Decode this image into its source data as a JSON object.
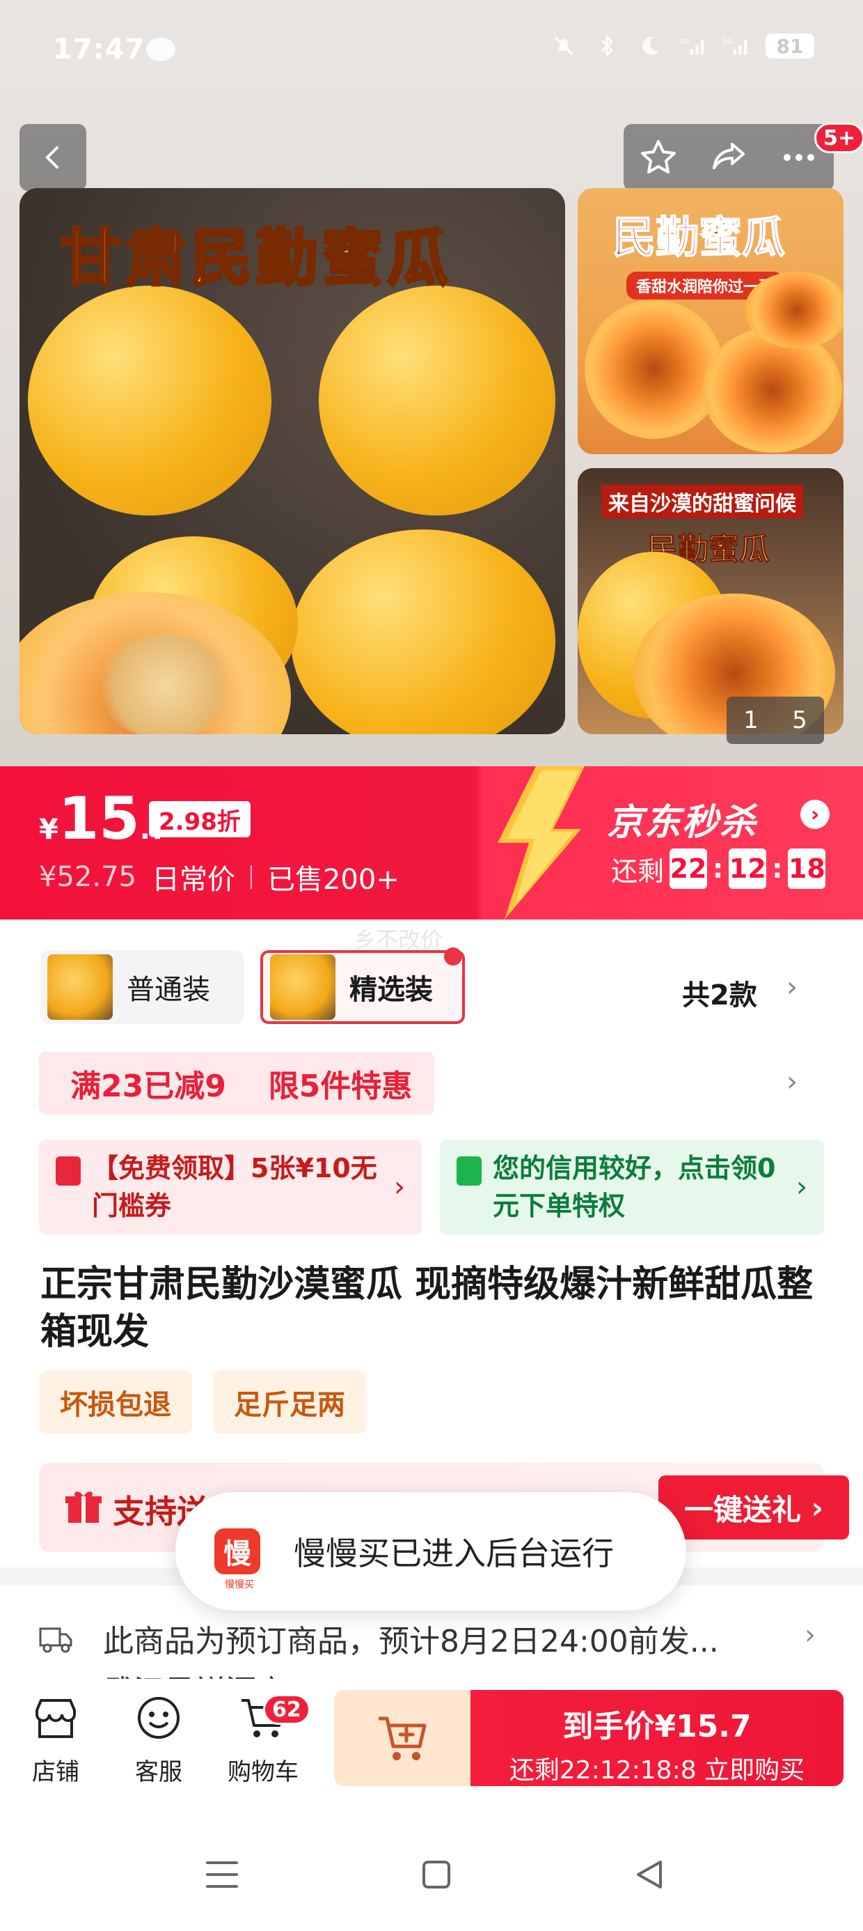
{
  "status_bar": {
    "time": "17:47",
    "icons": [
      "wechat-icon",
      "mute-icon",
      "bluetooth-icon",
      "moon-icon",
      "signal-5g-icon",
      "signal-5g-icon"
    ],
    "battery": "81"
  },
  "header": {
    "message_badge": "5+"
  },
  "gallery": {
    "main_title": "甘肃民勤蜜瓜",
    "side1_title": "民勤蜜瓜",
    "side1_subtitle": "香甜水润陪你过一夏",
    "side2_title": "来自沙漠的甜蜜问候",
    "side2_subtitle": "民勤蜜瓜",
    "pager_current": "1",
    "pager_total": "5"
  },
  "price": {
    "currency": "¥",
    "integer": "15",
    "decimal": ".7",
    "discount": "2.98折",
    "original": "¥52.75",
    "original_label": "日常价",
    "sold": "已售200+",
    "flash_title": "京东秒杀",
    "countdown_label": "还剩",
    "countdown": [
      "22",
      "12",
      "18"
    ]
  },
  "tip_text": "乡不改价",
  "variants": {
    "items": [
      {
        "label": "普通装"
      },
      {
        "label": "精选装"
      }
    ],
    "total": "共2款"
  },
  "promos": [
    "满23已减9",
    "限5件特惠"
  ],
  "coupons": [
    {
      "text": "【免费领取】5张¥10无门槛券"
    },
    {
      "text": "您的信用较好，点击领0元下单特权"
    }
  ],
  "product": {
    "title": "正宗甘肃民勤沙漠蜜瓜 现摘特级爆汁新鲜甜瓜整箱现发",
    "tags": [
      "坏损包退",
      "足斤足两"
    ]
  },
  "gift": {
    "text": "支持送",
    "button": "一键送礼"
  },
  "toast": {
    "logo": "慢",
    "logo_sub": "慢慢买",
    "text": "慢慢买已进入后台运行"
  },
  "shipping": {
    "text": "此商品为预订商品，预计8月2日24:00前发...",
    "text2": "武汉吴祥源方"
  },
  "bottom_bar": {
    "store": "店铺",
    "service": "客服",
    "cart": "购物车",
    "cart_badge": "62",
    "buy_line1": "到手价¥15.7",
    "buy_line2": "还剩22:12:18:8  立即购买"
  },
  "colors": {
    "brand_red": "#f2123a",
    "coupon_green": "#0b7d3a",
    "tag_orange": "#c8570e"
  }
}
